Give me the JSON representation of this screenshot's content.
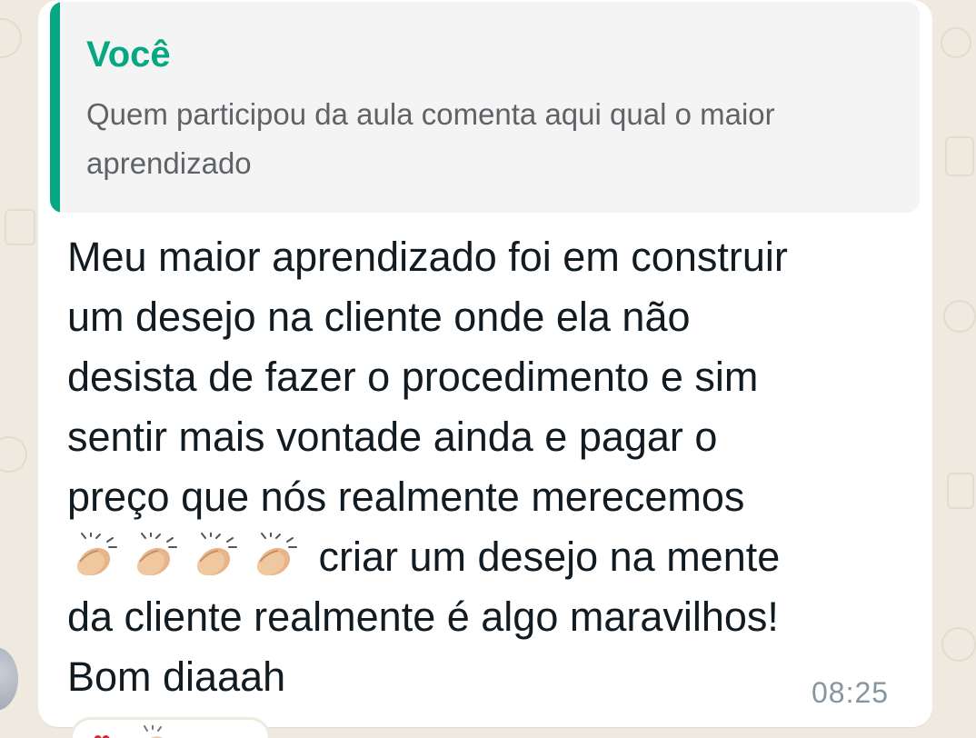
{
  "quote": {
    "author": "Você",
    "text": "Quem participou da aula comenta aqui qual o maior aprendizado"
  },
  "message": {
    "line1": "Meu maior aprendizado foi em construir",
    "line2": "um desejo na cliente onde ela não",
    "line3": "desista de fazer o procedimento e sim",
    "line4": "sentir mais vontade ainda e pagar o",
    "line5": "preço que nós realmente merecemos",
    "line6_text": "criar um desejo na mente",
    "line7": "da cliente realmente é algo maravilhos!",
    "line8": "Bom diaaah",
    "emojis": [
      "clapping-hands",
      "clapping-hands",
      "clapping-hands",
      "clapping-hands"
    ]
  },
  "timestamp": "08:25",
  "reactions": [
    "heart",
    "clapping-hands"
  ],
  "colors": {
    "accent": "#06a884",
    "bubble": "#ffffff",
    "quote_bg": "#f5f4f4",
    "timestamp": "#8696a0",
    "background": "#efe9df"
  }
}
